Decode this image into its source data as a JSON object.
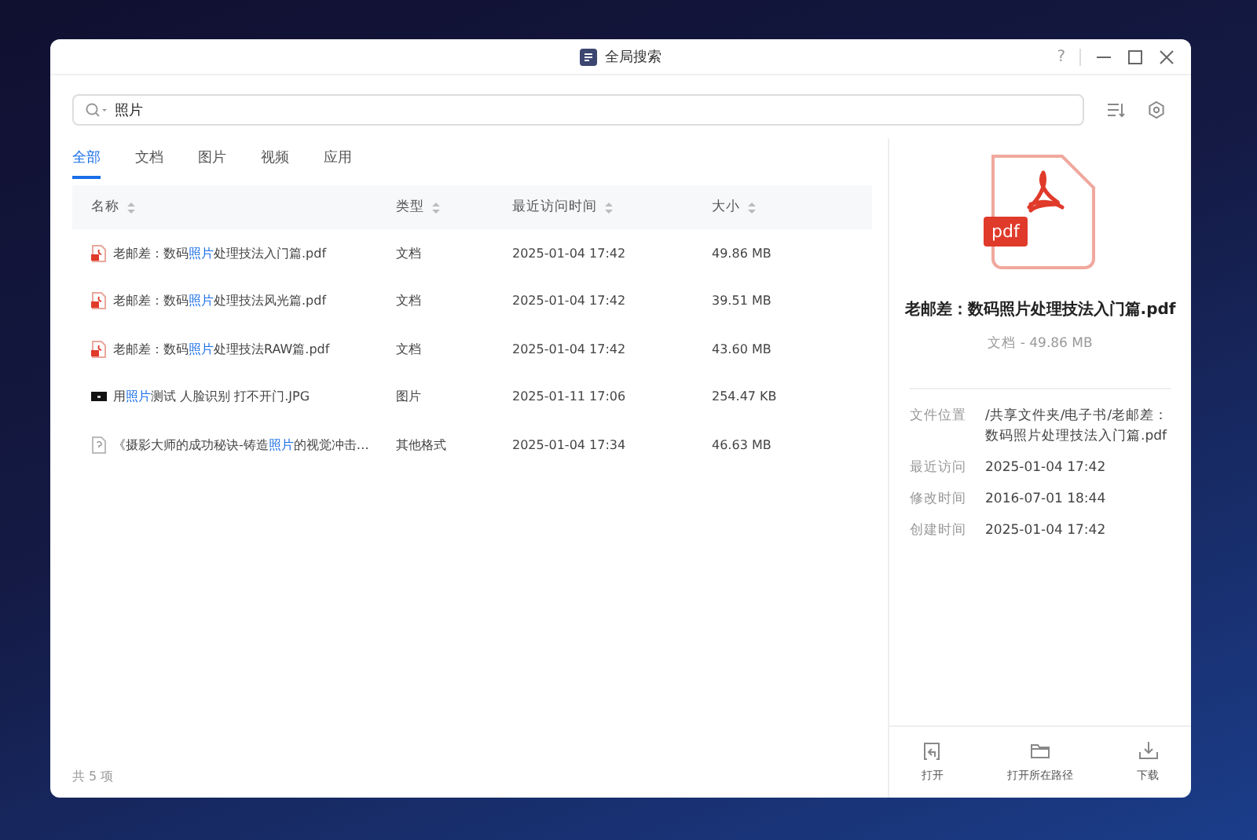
{
  "window": {
    "title": "全局搜索",
    "help": "?"
  },
  "search": {
    "value": "照片"
  },
  "tabs": [
    {
      "label": "全部",
      "selected": true
    },
    {
      "label": "文档",
      "selected": false
    },
    {
      "label": "图片",
      "selected": false
    },
    {
      "label": "视频",
      "selected": false
    },
    {
      "label": "应用",
      "selected": false
    }
  ],
  "table": {
    "columns": [
      "名称",
      "类型",
      "最近访问时间",
      "大小"
    ],
    "rows": [
      {
        "kind": "pdf",
        "name": {
          "before": "老邮差：数码",
          "match": "照片",
          "after": "处理技法入门篇.pdf"
        },
        "type": "文档",
        "accessed": "2025-01-04 17:42",
        "size": "49.86 MB"
      },
      {
        "kind": "pdf",
        "name": {
          "before": "老邮差：数码",
          "match": "照片",
          "after": "处理技法风光篇.pdf"
        },
        "type": "文档",
        "accessed": "2025-01-04 17:42",
        "size": "39.51 MB"
      },
      {
        "kind": "pdf",
        "name": {
          "before": "老邮差：数码",
          "match": "照片",
          "after": "处理技法RAW篇.pdf"
        },
        "type": "文档",
        "accessed": "2025-01-04 17:42",
        "size": "43.60 MB"
      },
      {
        "kind": "image",
        "name": {
          "before": "用",
          "match": "照片",
          "after": "测试 人脸识别 打不开门.JPG"
        },
        "type": "图片",
        "accessed": "2025-01-11 17:06",
        "size": "254.47 KB"
      },
      {
        "kind": "unknown",
        "name": {
          "before": "《摄影大师的成功秘诀-铸造",
          "match": "照片",
          "after": "的视觉冲击…"
        },
        "type": "其他格式",
        "accessed": "2025-01-04 17:34",
        "size": "46.63 MB"
      }
    ]
  },
  "footer": "共 5 项",
  "detail": {
    "badge": "pdf",
    "title": "老邮差：数码照片处理技法入门篇.pdf",
    "subtitle": "文档 - 49.86 MB",
    "fields": [
      {
        "label": "文件位置",
        "value": "/共享文件夹/电子书/老邮差：数码照片处理技法入门篇.pdf"
      },
      {
        "label": "最近访问",
        "value": "2025-01-04 17:42"
      },
      {
        "label": "修改时间",
        "value": "2016-07-01 18:44"
      },
      {
        "label": "创建时间",
        "value": "2025-01-04 17:42"
      }
    ],
    "actions": [
      {
        "kind": "open",
        "label": "打开"
      },
      {
        "kind": "folder",
        "label": "打开所在路径"
      },
      {
        "kind": "download",
        "label": "下载"
      }
    ]
  }
}
